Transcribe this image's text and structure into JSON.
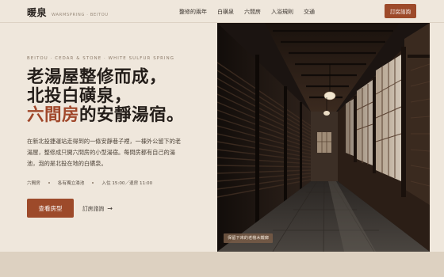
{
  "brand": {
    "name": "暖泉",
    "subtitle": "WARMSPRING · BEITOU"
  },
  "nav": {
    "items": [
      {
        "label": "整修的兩年"
      },
      {
        "label": "白磺泉"
      },
      {
        "label": "六間房"
      },
      {
        "label": "入浴規則"
      },
      {
        "label": "交通"
      }
    ],
    "cta_label": "訂房諮詢"
  },
  "hero": {
    "eyebrow": "BEITOU · CEDAR & STONE · WHITE SULFUR SPRING",
    "headline_line1": "老湯屋整修而成，",
    "headline_line2": "北投白磺泉，",
    "headline_line3_accent": "六間房",
    "headline_line3_rest": "的安靜湯宿。",
    "description": "在新北投捷運站走得到的一條安靜巷子裡，一棟外公留下的老湯屋，整修成只開六間房的小型湯宿。每間房都有自己的湯池，泡的是北投在地的白磺泉。",
    "meta": [
      "六間房",
      "各有獨立湯池",
      "入住 15:00／退房 11:00"
    ],
    "primary_button": "查看房型",
    "secondary_link": "訂房諮詢",
    "secondary_arrow": "→"
  },
  "photo": {
    "caption": "保留下來的老檜木鐵廊"
  },
  "colors": {
    "background": "#efe7dc",
    "accent": "#9d4a2a",
    "text": "#231d19"
  }
}
